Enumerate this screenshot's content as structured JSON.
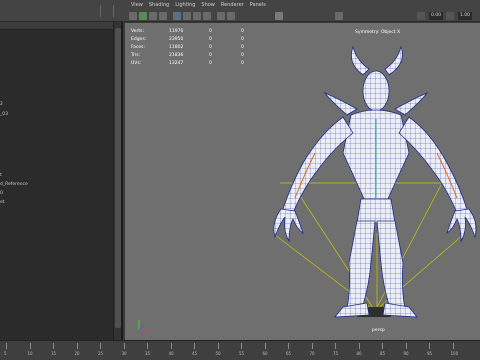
{
  "viewport_menu": [
    "View",
    "Shading",
    "Lighting",
    "Show",
    "Renderer",
    "Panels"
  ],
  "toolbar": {
    "field1": "0.00",
    "field2": "1.00",
    "icons": [
      "camera-icon",
      "lock-icon",
      "bookmark-icon",
      "grid-icon",
      "wireframe-icon",
      "smooth-shade-icon",
      "textured-icon",
      "lights-icon",
      "shadow-icon",
      "isolate-icon",
      "xray-icon",
      "gamma-icon"
    ]
  },
  "outliner": {
    "items": [
      "2",
      "_03",
      "t",
      "d_Reference",
      "0",
      "et"
    ]
  },
  "hud": {
    "rows": [
      {
        "label": "Verts:",
        "value": "11976",
        "c1": "0",
        "c2": "0"
      },
      {
        "label": "Edges:",
        "value": "23950",
        "c1": "0",
        "c2": "0"
      },
      {
        "label": "Faces:",
        "value": "11802",
        "c1": "0",
        "c2": "0"
      },
      {
        "label": "Tris:",
        "value": "21836",
        "c1": "0",
        "c2": "0"
      },
      {
        "label": "UVs:",
        "value": "13247",
        "c1": "0",
        "c2": "0"
      }
    ],
    "symmetry": "Symmetry: Object X",
    "camera": "persp"
  },
  "colors": {
    "viewport_bg": "#6f6f6f",
    "mesh_fill": "#e9ebf5",
    "wire": "#1f2c8c",
    "ground": "#c8c800"
  },
  "timeline": {
    "labels": [
      "5",
      "10",
      "15",
      "20",
      "25",
      "30",
      "35",
      "40",
      "45",
      "50",
      "55",
      "60",
      "65",
      "70",
      "75",
      "80",
      "85",
      "90",
      "95",
      "100"
    ]
  }
}
